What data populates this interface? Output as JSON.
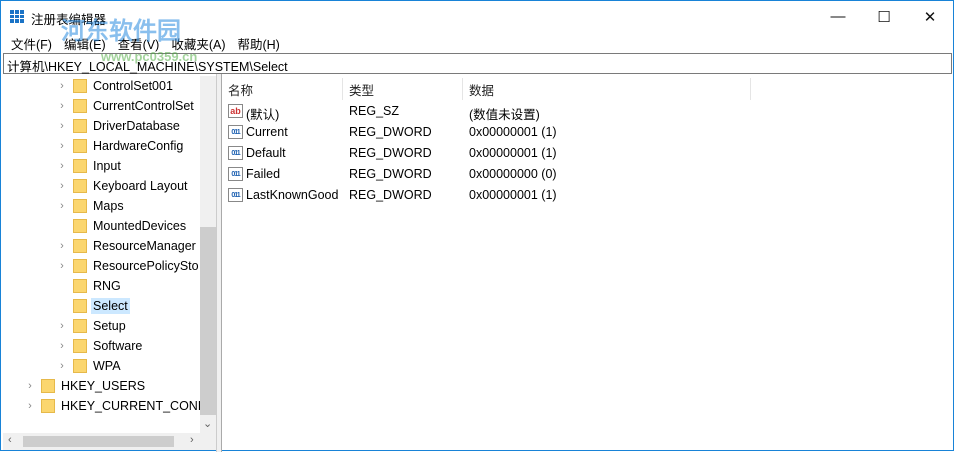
{
  "window": {
    "title": "注册表编辑器",
    "minimize": "—",
    "maximize": "☐",
    "close": "✕"
  },
  "watermark": {
    "text": "河东软件园",
    "url": "www.pc0359.cn"
  },
  "menu": [
    "文件(F)",
    "编辑(E)",
    "查看(V)",
    "收藏夹(A)",
    "帮助(H)"
  ],
  "address": "计算机\\HKEY_LOCAL_MACHINE\\SYSTEM\\Select",
  "tree": [
    {
      "label": "ControlSet001",
      "level": 2,
      "expandable": true
    },
    {
      "label": "CurrentControlSet",
      "level": 2,
      "expandable": true
    },
    {
      "label": "DriverDatabase",
      "level": 2,
      "expandable": true
    },
    {
      "label": "HardwareConfig",
      "level": 2,
      "expandable": true
    },
    {
      "label": "Input",
      "level": 2,
      "expandable": true
    },
    {
      "label": "Keyboard Layout",
      "level": 2,
      "expandable": true
    },
    {
      "label": "Maps",
      "level": 2,
      "expandable": true
    },
    {
      "label": "MountedDevices",
      "level": 2,
      "expandable": false
    },
    {
      "label": "ResourceManager",
      "level": 2,
      "expandable": true
    },
    {
      "label": "ResourcePolicySto",
      "level": 2,
      "expandable": true
    },
    {
      "label": "RNG",
      "level": 2,
      "expandable": false
    },
    {
      "label": "Select",
      "level": 2,
      "expandable": false,
      "selected": true
    },
    {
      "label": "Setup",
      "level": 2,
      "expandable": true
    },
    {
      "label": "Software",
      "level": 2,
      "expandable": true
    },
    {
      "label": "WPA",
      "level": 2,
      "expandable": true
    },
    {
      "label": "HKEY_USERS",
      "level": 1,
      "expandable": true
    },
    {
      "label": "HKEY_CURRENT_CONFIG",
      "level": 1,
      "expandable": true
    }
  ],
  "columns": [
    "名称",
    "类型",
    "数据"
  ],
  "values": [
    {
      "name": "(默认)",
      "type": "REG_SZ",
      "data": "(数值未设置)",
      "icon": "ab"
    },
    {
      "name": "Current",
      "type": "REG_DWORD",
      "data": "0x00000001 (1)",
      "icon": "011"
    },
    {
      "name": "Default",
      "type": "REG_DWORD",
      "data": "0x00000001 (1)",
      "icon": "011"
    },
    {
      "name": "Failed",
      "type": "REG_DWORD",
      "data": "0x00000000 (0)",
      "icon": "011"
    },
    {
      "name": "LastKnownGood",
      "type": "REG_DWORD",
      "data": "0x00000001 (1)",
      "icon": "011"
    }
  ]
}
